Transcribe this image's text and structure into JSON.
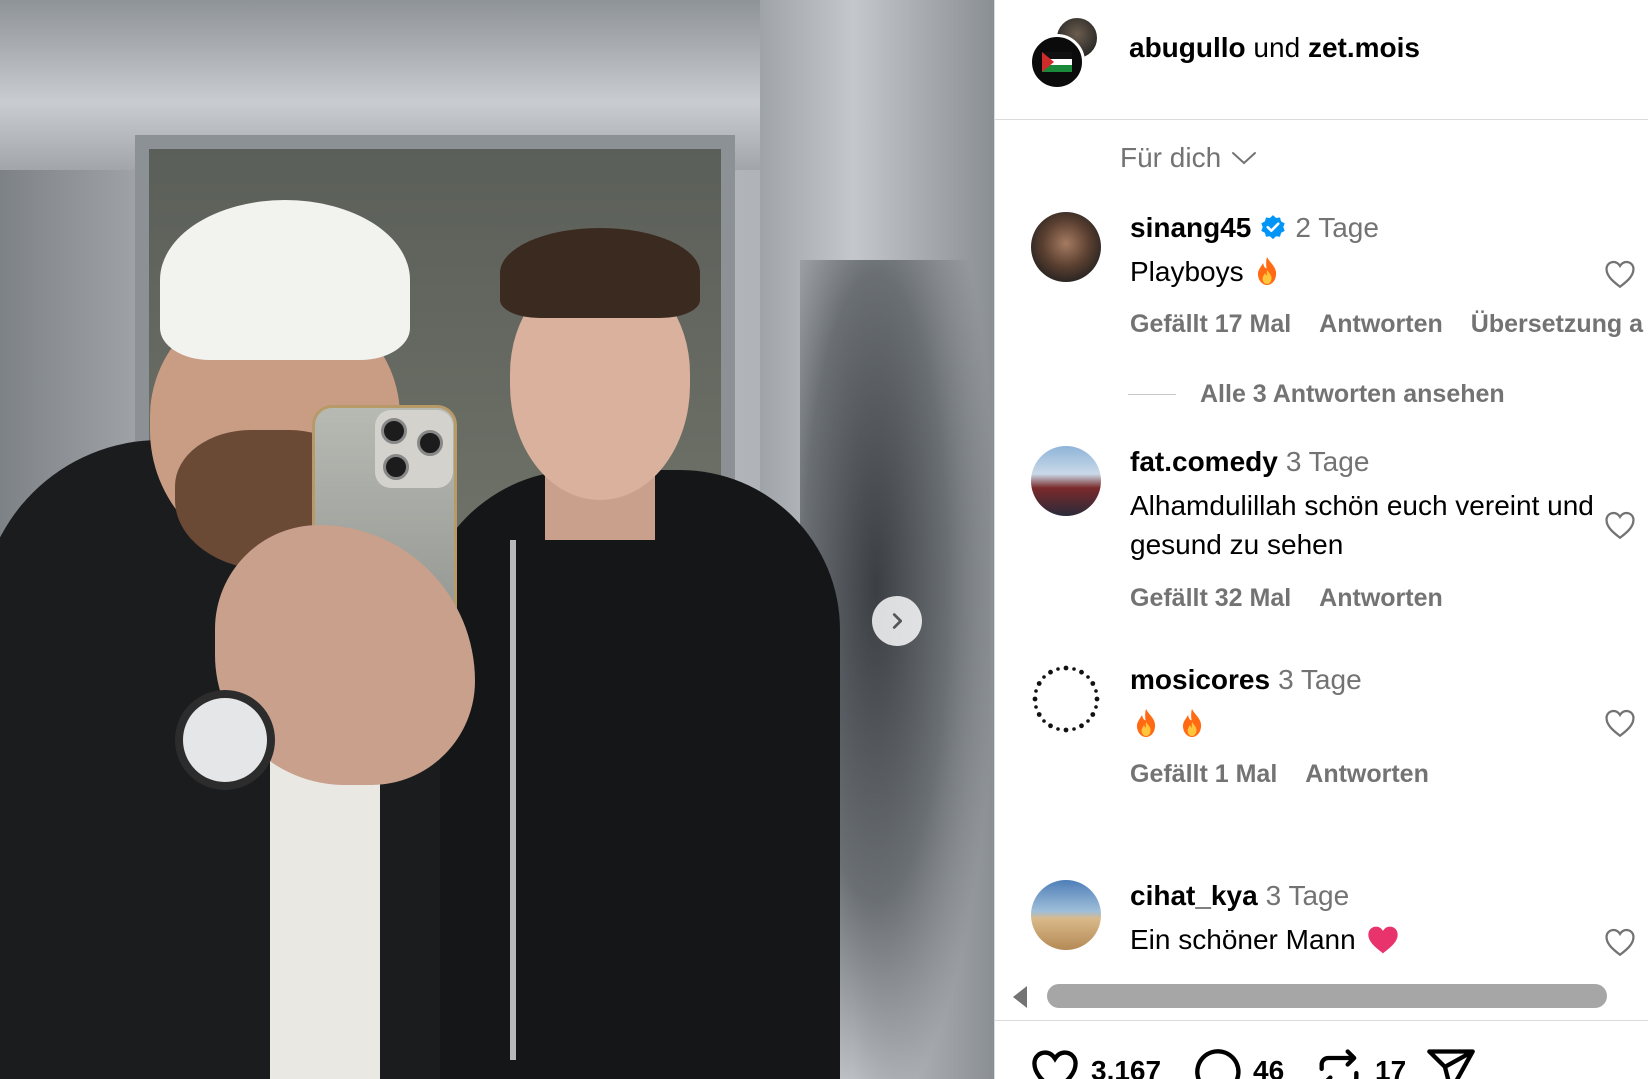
{
  "header": {
    "user1": "abugullo",
    "connector": " und ",
    "user2": "zet.mois"
  },
  "sort": {
    "label": "Für dich"
  },
  "comments": [
    {
      "username": "sinang45",
      "verified": true,
      "time": "2 Tage",
      "text": "Playboys",
      "likes": "Gefällt 17 Mal",
      "reply": "Antworten",
      "translate": "Übersetzung a"
    },
    {
      "username": "fat.comedy",
      "time": "3 Tage",
      "text": "Alhamdulillah schön euch vereint und gesund zu sehen",
      "likes": "Gefällt 32 Mal",
      "reply": "Antworten"
    },
    {
      "username": "mosicores",
      "time": "3 Tage",
      "text": "",
      "likes": "Gefällt 1 Mal",
      "reply": "Antworten"
    },
    {
      "username": "cihat_kya",
      "time": "3 Tage",
      "text": "Ein schöner Mann"
    }
  ],
  "view_replies": "Alle 3 Antworten ansehen",
  "actions": {
    "likes": "3.167",
    "comments": "46",
    "reposts": "17"
  },
  "colors": {
    "text_secondary": "#737373",
    "verified": "#0095f6",
    "divider": "#dbdbdb",
    "flame": "#ff6a13",
    "heart_emoji": "#e8336d"
  },
  "icons": [
    "next-arrow-icon",
    "chevron-down-icon",
    "verified-badge-icon",
    "heart-outline-icon",
    "comment-bubble-icon",
    "repost-icon",
    "share-send-icon",
    "fire-emoji",
    "heart-emoji"
  ]
}
